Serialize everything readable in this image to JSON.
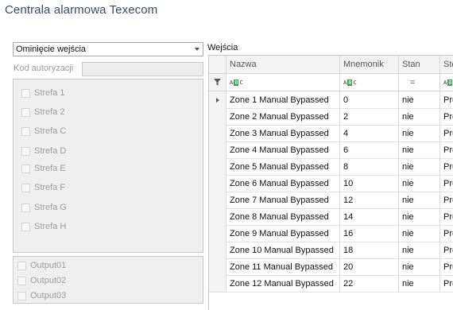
{
  "window": {
    "title": "Centrala alarmowa Texecom"
  },
  "mode_select": {
    "value": "Ominięcie wejścia"
  },
  "auth": {
    "label": "Kod autoryzacji",
    "value": ""
  },
  "zones": [
    "Strefa 1",
    "Strefa 2",
    "Strefa C",
    "Strefa D",
    "Strefa E",
    "Strefa F",
    "Strefa G",
    "Strefa H"
  ],
  "outputs": [
    "Output01",
    "Output02",
    "Output03"
  ],
  "grid": {
    "label": "Wejścia",
    "columns": [
      "Nazwa",
      "Mnemonik",
      "Stan",
      "Ste"
    ],
    "filter_placeholder_icon": "abc-filter-icon",
    "rows": [
      {
        "name": "Zone 1 Manual Bypassed",
        "mnemonic": "0",
        "state": "nie",
        "ste": "Pre"
      },
      {
        "name": "Zone 2 Manual Bypassed",
        "mnemonic": "2",
        "state": "nie",
        "ste": "Pre"
      },
      {
        "name": "Zone 3 Manual Bypassed",
        "mnemonic": "4",
        "state": "nie",
        "ste": "Pre"
      },
      {
        "name": "Zone 4 Manual Bypassed",
        "mnemonic": "6",
        "state": "nie",
        "ste": "Pre"
      },
      {
        "name": "Zone 5 Manual Bypassed",
        "mnemonic": "8",
        "state": "nie",
        "ste": "Pre"
      },
      {
        "name": "Zone 6 Manual Bypassed",
        "mnemonic": "10",
        "state": "nie",
        "ste": "Pre"
      },
      {
        "name": "Zone 7 Manual Bypassed",
        "mnemonic": "12",
        "state": "nie",
        "ste": "Pre"
      },
      {
        "name": "Zone 8 Manual Bypassed",
        "mnemonic": "14",
        "state": "nie",
        "ste": "Pre"
      },
      {
        "name": "Zone 9 Manual Bypassed",
        "mnemonic": "16",
        "state": "nie",
        "ste": "Pre"
      },
      {
        "name": "Zone 10 Manual Bypassed",
        "mnemonic": "18",
        "state": "nie",
        "ste": "Pre"
      },
      {
        "name": "Zone 11 Manual Bypassed",
        "mnemonic": "20",
        "state": "nie",
        "ste": "Pre"
      },
      {
        "name": "Zone 12 Manual Bypassed",
        "mnemonic": "22",
        "state": "nie",
        "ste": "Pre"
      }
    ]
  }
}
